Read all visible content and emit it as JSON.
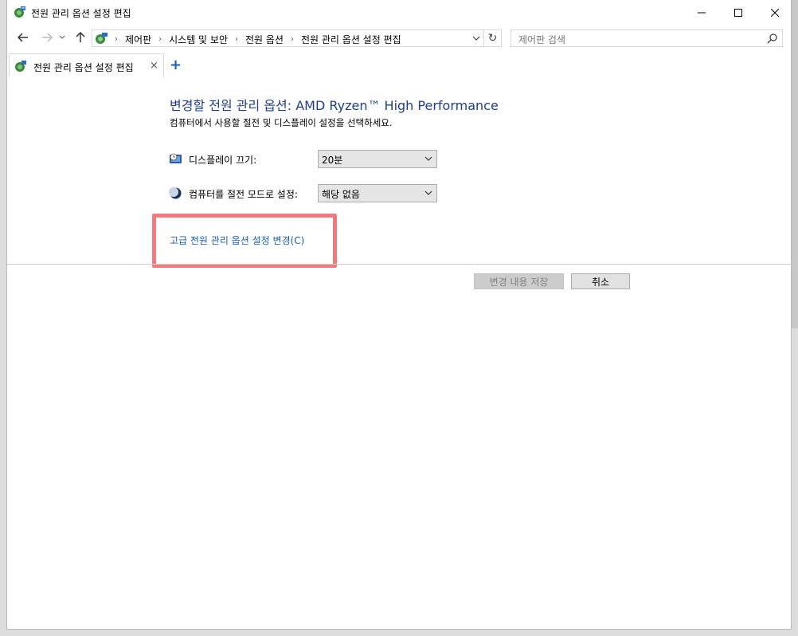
{
  "window": {
    "title": "전원 관리 옵션 설정 편집"
  },
  "nav": {
    "breadcrumbs": [
      "제어판",
      "시스템 및 보안",
      "전원 옵션",
      "전원 관리 옵션 설정 편집"
    ],
    "search_placeholder": "제어판 검색"
  },
  "tab": {
    "label": "전원 관리 옵션 설정 편집",
    "close": "×",
    "add": "+"
  },
  "main": {
    "heading": "변경할 전원 관리 옵션: AMD Ryzen™ High Performance",
    "subheading": "컴퓨터에서 사용할 절전 및 디스플레이 설정을 선택하세요.",
    "display_off": {
      "label": "디스플레이 끄기:",
      "value": "20분",
      "icon": "monitor-clock-icon"
    },
    "sleep": {
      "label": "컴퓨터를 절전 모드로 설정:",
      "value": "해당 없음",
      "icon": "moon-icon"
    },
    "advanced_link": "고급 전원 관리 옵션 설정 변경(C)",
    "save_button": "변경 내용 저장",
    "cancel_button": "취소"
  },
  "colors": {
    "heading": "#1e3f8c",
    "link": "#1a5fb4",
    "highlight": "#f07a7d"
  }
}
